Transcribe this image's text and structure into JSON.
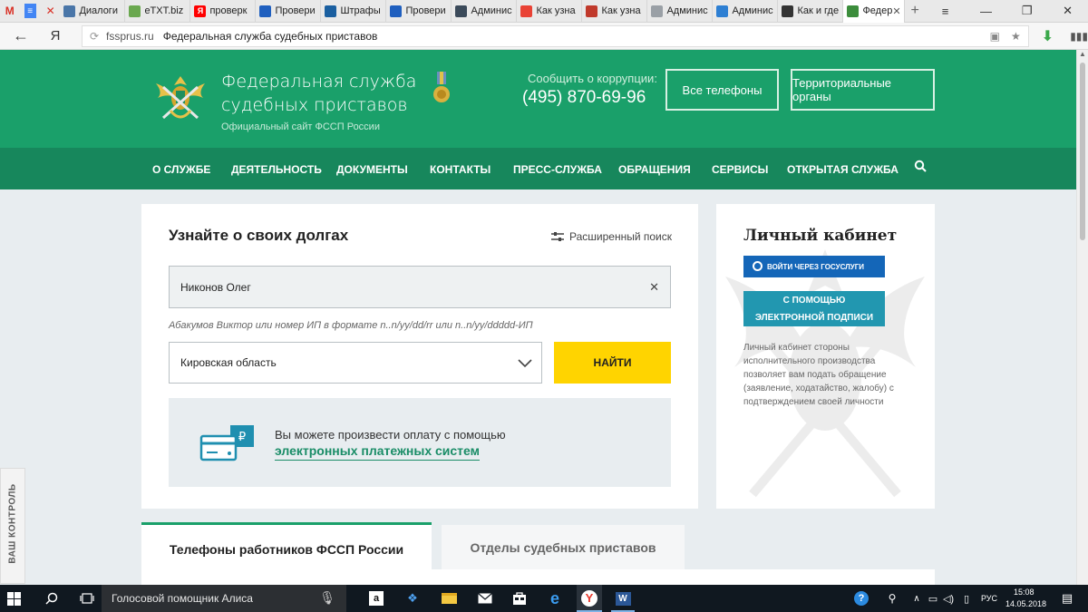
{
  "browser": {
    "app_icons": [
      "M",
      "≡",
      "✕"
    ],
    "tabs": [
      {
        "label": "Диалоги",
        "favicon_color": "#4a76a8"
      },
      {
        "label": "eTXT.biz",
        "favicon_color": "#6aa84f"
      },
      {
        "label": "проверк",
        "favicon_color": "#ff0000",
        "favicon_text": "Я"
      },
      {
        "label": "Провери",
        "favicon_color": "#1f5fbf"
      },
      {
        "label": "Штрафы",
        "favicon_color": "#1a5fa0"
      },
      {
        "label": "Провери",
        "favicon_color": "#1f5fbf"
      },
      {
        "label": "Админис",
        "favicon_color": "#3b4a5a"
      },
      {
        "label": "Как узна",
        "favicon_color": "#e94235"
      },
      {
        "label": "Как узна",
        "favicon_color": "#c0392b"
      },
      {
        "label": "Админис",
        "favicon_color": "#9aa0a6"
      },
      {
        "label": "Админис",
        "favicon_color": "#2d7fd3"
      },
      {
        "label": "Как и где",
        "favicon_color": "#333333"
      },
      {
        "label": "Федер",
        "favicon_color": "#3c8d3c",
        "active": true
      }
    ],
    "new_tab_label": "+",
    "window_controls": [
      "≡",
      "—",
      "❐",
      "✕"
    ],
    "address": {
      "back_label": "←",
      "yandex_label": "Я",
      "domain": "fssprus.ru",
      "page_title": "Федеральная служба судебных приставов"
    }
  },
  "site": {
    "title": "Федеральная служба судебных приставов",
    "subtitle": "Официальный сайт ФССП России",
    "corruption_label": "Сообщить о коррупции:",
    "corruption_phone": "(495) 870-69-96",
    "buttons": {
      "all_phones": "Все телефоны",
      "territorial": "Территориальные органы"
    },
    "nav": [
      "О СЛУЖБЕ",
      "ДЕЯТЕЛЬНОСТЬ",
      "ДОКУМЕНТЫ",
      "КОНТАКТЫ",
      "ПРЕСС-СЛУЖБА",
      "ОБРАЩЕНИЯ",
      "СЕРВИСЫ",
      "ОТКРЫТАЯ СЛУЖБА"
    ],
    "colors": {
      "header_green": "#1aa06a",
      "nav_green": "#17875c",
      "find_yellow": "#ffd400",
      "gosuslugi_blue": "#1466b8",
      "signature_teal": "#2297b0"
    }
  },
  "search": {
    "title": "Узнайте о своих долгах",
    "advanced_label": "Расширенный поиск",
    "query_value": "Никонов Олег",
    "hint": "Абакумов Виктор или номер ИП в формате n..n/yy/dd/rr или n..n/yy/ddddd-ИП",
    "region_value": "Кировская область",
    "find_label": "НАЙТИ",
    "pay_text": "Вы можете произвести оплату с помощью",
    "pay_link": "электронных платежных систем",
    "pay_currency": "₽"
  },
  "cabinet": {
    "title": "Личный кабинет",
    "gosuslugi_label": "ВОЙТИ ЧЕРЕЗ ГОСУСЛУГИ",
    "signature_line1": "С ПОМОЩЬЮ",
    "signature_line2": "ЭЛЕКТРОННОЙ ПОДПИСИ",
    "description": "Личный кабинет стороны исполнительного производства позволяет вам подать обращение (заявление, ходатайство, жалобу) с подтверждением своей личности"
  },
  "bottom_tabs": {
    "active": "Телефоны работников ФССП России",
    "inactive": "Отделы судебных приставов"
  },
  "side_badge": "ВАШ КОНТРОЛЬ",
  "taskbar": {
    "alice_label": "Голосовой помощник Алиса",
    "language": "РУС",
    "time": "15:08",
    "date": "14.05.2018"
  }
}
